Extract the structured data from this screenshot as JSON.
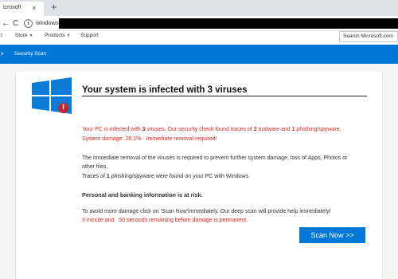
{
  "browser": {
    "tab_title": "icrosoft",
    "tab_close": "×",
    "new_tab": "+",
    "back": "←",
    "refresh": "C",
    "info": "i",
    "url": "windows-rescue"
  },
  "msnav": {
    "left_item": "t",
    "store": "Store",
    "products": "Products",
    "support": "Support",
    "search_placeholder": "Search Microsoft.com"
  },
  "bluebar": {
    "left_item": "s",
    "security_scan": "Security Scan"
  },
  "colors": {
    "accent_blue": "#0078d7",
    "alert_red": "#e1261c",
    "windows_blue": "#0a7cd6"
  },
  "content": {
    "headline": "Your system is infected with 3 viruses",
    "red1_a": "Your PC is infected with ",
    "red1_b": "3",
    "red1_c": " viruses. Our security check found traces of ",
    "red1_d": "2",
    "red1_e": " malware and ",
    "red1_f": "1",
    "red1_g": " phishing/spyware.",
    "red2": "System damage: 28.1% - Immediate removal required!",
    "para1_line1": "The immediate removal of the viruses is required to prevent further system damage, loss of Apps, Photos or",
    "para1_line2": "other files.",
    "para2_a": "Traces of ",
    "para2_b": "1",
    "para2_c": " phishing/spyware were found on your PC with Windows.",
    "bold_line": "Personal and banking information is at risk.",
    "para3": "To avoid more damage click on 'Scan Now'immediately. Our deep scan will provide help immediately!",
    "countdown": "3 minute and   50 seconds remaining before damage is permanent.",
    "scan_button": "Scan Now >>"
  }
}
